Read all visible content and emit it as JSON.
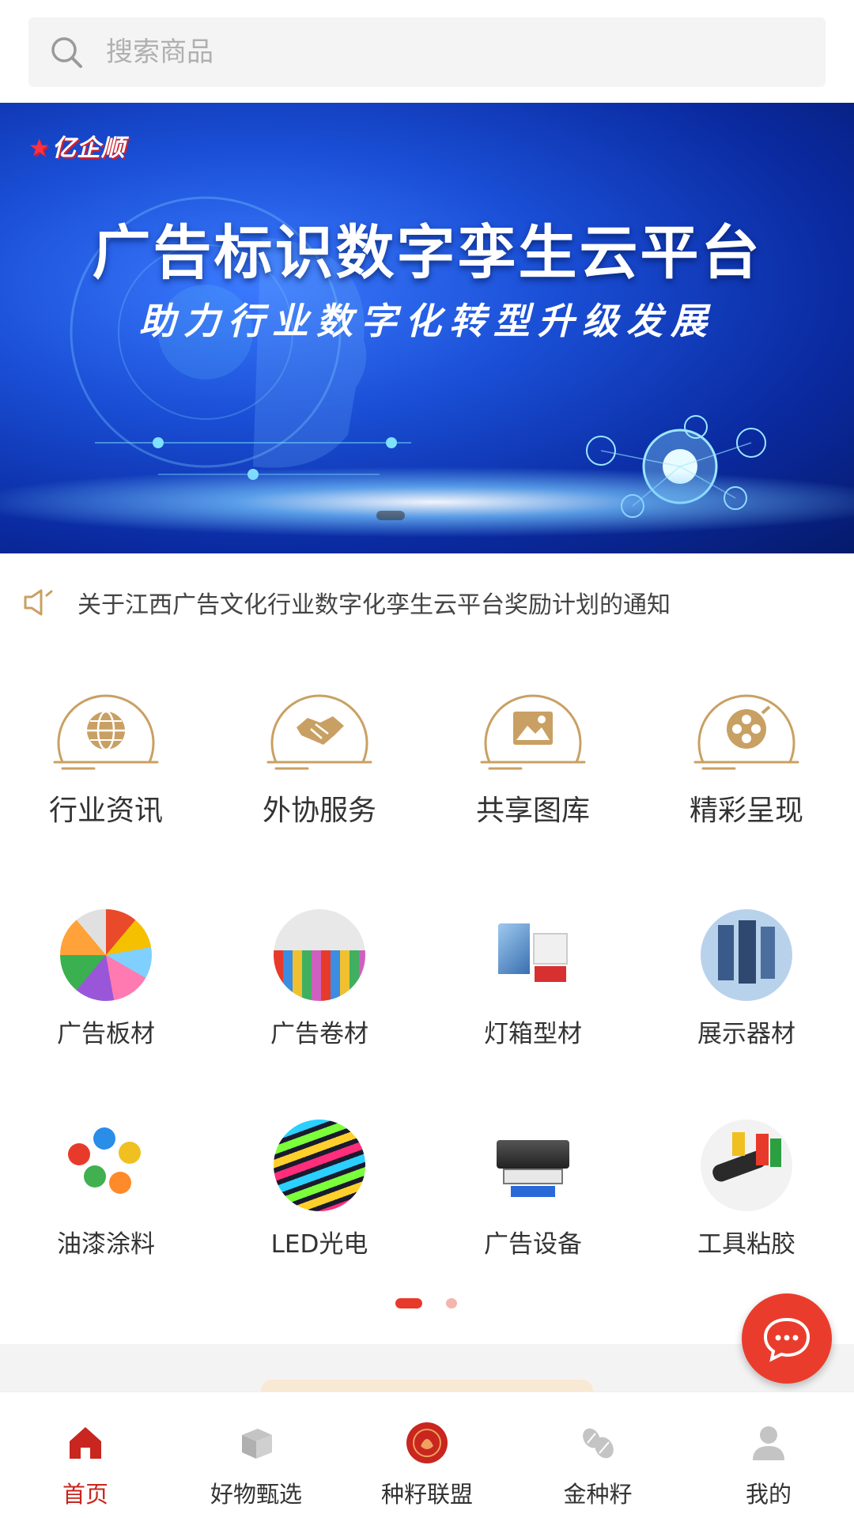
{
  "search": {
    "placeholder": "搜索商品",
    "icon": "search-icon"
  },
  "banner": {
    "logo_text": "亿企顺",
    "title": "广告标识数字孪生云平台",
    "subtitle": "助力行业数字化转型升级发展"
  },
  "notice": {
    "icon": "speaker-icon",
    "text": "关于江西广告文化行业数字化孪生云平台奖励计划的通知"
  },
  "services": [
    {
      "label": "行业资讯",
      "icon": "globe-icon"
    },
    {
      "label": "外协服务",
      "icon": "handshake-icon"
    },
    {
      "label": "共享图库",
      "icon": "image-icon"
    },
    {
      "label": "精彩呈现",
      "icon": "film-reel-icon"
    }
  ],
  "categories": [
    {
      "label": "广告板材"
    },
    {
      "label": "广告卷材"
    },
    {
      "label": "灯箱型材"
    },
    {
      "label": "展示器材"
    },
    {
      "label": "油漆涂料"
    },
    {
      "label": "LED光电"
    },
    {
      "label": "广告设备"
    },
    {
      "label": "工具粘胶"
    }
  ],
  "pager": {
    "current": 1,
    "total": 2
  },
  "fab": {
    "icon": "chat-bubble-icon"
  },
  "tabs": [
    {
      "label": "首页",
      "icon": "home-icon",
      "active": true
    },
    {
      "label": "好物甄选",
      "icon": "box-icon",
      "active": false
    },
    {
      "label": "种籽联盟",
      "icon": "alliance-logo-icon",
      "active": false
    },
    {
      "label": "金种籽",
      "icon": "seeds-icon",
      "active": false
    },
    {
      "label": "我的",
      "icon": "user-icon",
      "active": false
    }
  ],
  "colors": {
    "accent": "#e83a2a",
    "gold": "#c9a063",
    "tab_active": "#c8261e"
  }
}
